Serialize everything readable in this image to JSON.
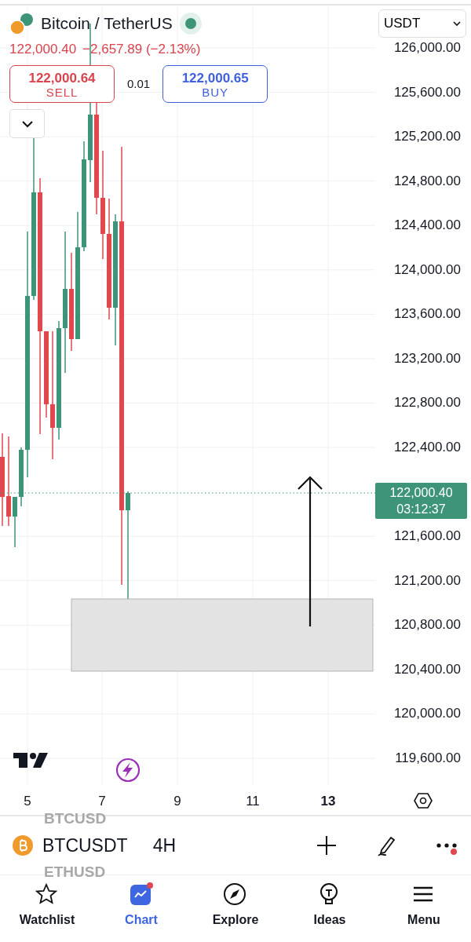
{
  "header": {
    "title": "Bitcoin / TetherUS",
    "market_open": true,
    "price": "122,000.40",
    "change": "−2,657.89 (−2.13%)",
    "currency": "USDT"
  },
  "trade": {
    "sell_price": "122,000.64",
    "sell_label": "SELL",
    "spread": "0.01",
    "buy_price": "122,000.65",
    "buy_label": "BUY"
  },
  "price_axis": {
    "labels": [
      "126,000.00",
      "125,600.00",
      "125,200.00",
      "124,800.00",
      "124,400.00",
      "124,000.00",
      "123,600.00",
      "123,200.00",
      "122,800.00",
      "122,400.00",
      "121,600.00",
      "121,200.00",
      "120,800.00",
      "120,400.00",
      "120,000.00",
      "119,600.00"
    ],
    "current_price": "122,000.40",
    "countdown": "03:12:37"
  },
  "time_axis": [
    {
      "label": "5",
      "current": false
    },
    {
      "label": "7",
      "current": false
    },
    {
      "label": "9",
      "current": false
    },
    {
      "label": "11",
      "current": false
    },
    {
      "label": "13",
      "current": true
    }
  ],
  "symbol_bar": {
    "above": "BTCUSD",
    "symbol": "BTCUSDT",
    "interval": "4H",
    "below": "ETHUSD",
    "more_badge": true
  },
  "tabs": [
    {
      "label": "Watchlist",
      "selected": false,
      "badge": false
    },
    {
      "label": "Chart",
      "selected": true,
      "badge": true
    },
    {
      "label": "Explore",
      "selected": false,
      "badge": false
    },
    {
      "label": "Ideas",
      "selected": false,
      "badge": false
    },
    {
      "label": "Menu",
      "selected": false,
      "badge": false
    }
  ]
}
